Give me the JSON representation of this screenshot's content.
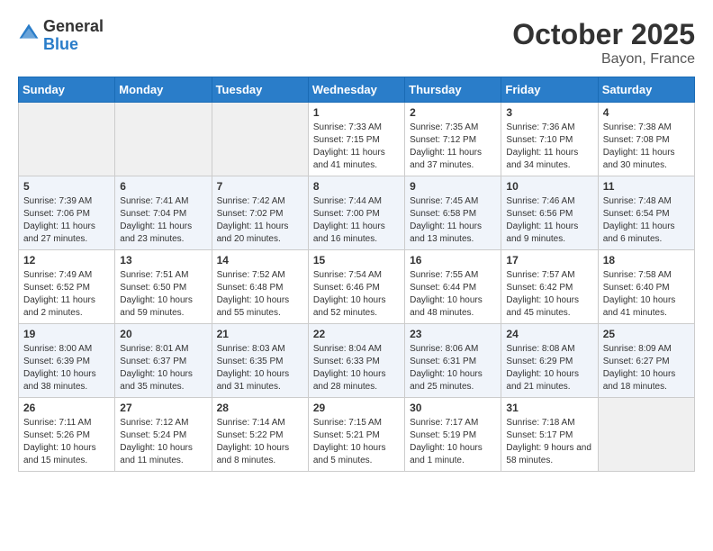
{
  "header": {
    "logo_general": "General",
    "logo_blue": "Blue",
    "month_year": "October 2025",
    "location": "Bayon, France"
  },
  "days_of_week": [
    "Sunday",
    "Monday",
    "Tuesday",
    "Wednesday",
    "Thursday",
    "Friday",
    "Saturday"
  ],
  "weeks": [
    [
      {
        "day": "",
        "sunrise": "",
        "sunset": "",
        "daylight": "",
        "empty": true
      },
      {
        "day": "",
        "sunrise": "",
        "sunset": "",
        "daylight": "",
        "empty": true
      },
      {
        "day": "",
        "sunrise": "",
        "sunset": "",
        "daylight": "",
        "empty": true
      },
      {
        "day": "1",
        "sunrise": "Sunrise: 7:33 AM",
        "sunset": "Sunset: 7:15 PM",
        "daylight": "Daylight: 11 hours and 41 minutes."
      },
      {
        "day": "2",
        "sunrise": "Sunrise: 7:35 AM",
        "sunset": "Sunset: 7:12 PM",
        "daylight": "Daylight: 11 hours and 37 minutes."
      },
      {
        "day": "3",
        "sunrise": "Sunrise: 7:36 AM",
        "sunset": "Sunset: 7:10 PM",
        "daylight": "Daylight: 11 hours and 34 minutes."
      },
      {
        "day": "4",
        "sunrise": "Sunrise: 7:38 AM",
        "sunset": "Sunset: 7:08 PM",
        "daylight": "Daylight: 11 hours and 30 minutes."
      }
    ],
    [
      {
        "day": "5",
        "sunrise": "Sunrise: 7:39 AM",
        "sunset": "Sunset: 7:06 PM",
        "daylight": "Daylight: 11 hours and 27 minutes."
      },
      {
        "day": "6",
        "sunrise": "Sunrise: 7:41 AM",
        "sunset": "Sunset: 7:04 PM",
        "daylight": "Daylight: 11 hours and 23 minutes."
      },
      {
        "day": "7",
        "sunrise": "Sunrise: 7:42 AM",
        "sunset": "Sunset: 7:02 PM",
        "daylight": "Daylight: 11 hours and 20 minutes."
      },
      {
        "day": "8",
        "sunrise": "Sunrise: 7:44 AM",
        "sunset": "Sunset: 7:00 PM",
        "daylight": "Daylight: 11 hours and 16 minutes."
      },
      {
        "day": "9",
        "sunrise": "Sunrise: 7:45 AM",
        "sunset": "Sunset: 6:58 PM",
        "daylight": "Daylight: 11 hours and 13 minutes."
      },
      {
        "day": "10",
        "sunrise": "Sunrise: 7:46 AM",
        "sunset": "Sunset: 6:56 PM",
        "daylight": "Daylight: 11 hours and 9 minutes."
      },
      {
        "day": "11",
        "sunrise": "Sunrise: 7:48 AM",
        "sunset": "Sunset: 6:54 PM",
        "daylight": "Daylight: 11 hours and 6 minutes."
      }
    ],
    [
      {
        "day": "12",
        "sunrise": "Sunrise: 7:49 AM",
        "sunset": "Sunset: 6:52 PM",
        "daylight": "Daylight: 11 hours and 2 minutes."
      },
      {
        "day": "13",
        "sunrise": "Sunrise: 7:51 AM",
        "sunset": "Sunset: 6:50 PM",
        "daylight": "Daylight: 10 hours and 59 minutes."
      },
      {
        "day": "14",
        "sunrise": "Sunrise: 7:52 AM",
        "sunset": "Sunset: 6:48 PM",
        "daylight": "Daylight: 10 hours and 55 minutes."
      },
      {
        "day": "15",
        "sunrise": "Sunrise: 7:54 AM",
        "sunset": "Sunset: 6:46 PM",
        "daylight": "Daylight: 10 hours and 52 minutes."
      },
      {
        "day": "16",
        "sunrise": "Sunrise: 7:55 AM",
        "sunset": "Sunset: 6:44 PM",
        "daylight": "Daylight: 10 hours and 48 minutes."
      },
      {
        "day": "17",
        "sunrise": "Sunrise: 7:57 AM",
        "sunset": "Sunset: 6:42 PM",
        "daylight": "Daylight: 10 hours and 45 minutes."
      },
      {
        "day": "18",
        "sunrise": "Sunrise: 7:58 AM",
        "sunset": "Sunset: 6:40 PM",
        "daylight": "Daylight: 10 hours and 41 minutes."
      }
    ],
    [
      {
        "day": "19",
        "sunrise": "Sunrise: 8:00 AM",
        "sunset": "Sunset: 6:39 PM",
        "daylight": "Daylight: 10 hours and 38 minutes."
      },
      {
        "day": "20",
        "sunrise": "Sunrise: 8:01 AM",
        "sunset": "Sunset: 6:37 PM",
        "daylight": "Daylight: 10 hours and 35 minutes."
      },
      {
        "day": "21",
        "sunrise": "Sunrise: 8:03 AM",
        "sunset": "Sunset: 6:35 PM",
        "daylight": "Daylight: 10 hours and 31 minutes."
      },
      {
        "day": "22",
        "sunrise": "Sunrise: 8:04 AM",
        "sunset": "Sunset: 6:33 PM",
        "daylight": "Daylight: 10 hours and 28 minutes."
      },
      {
        "day": "23",
        "sunrise": "Sunrise: 8:06 AM",
        "sunset": "Sunset: 6:31 PM",
        "daylight": "Daylight: 10 hours and 25 minutes."
      },
      {
        "day": "24",
        "sunrise": "Sunrise: 8:08 AM",
        "sunset": "Sunset: 6:29 PM",
        "daylight": "Daylight: 10 hours and 21 minutes."
      },
      {
        "day": "25",
        "sunrise": "Sunrise: 8:09 AM",
        "sunset": "Sunset: 6:27 PM",
        "daylight": "Daylight: 10 hours and 18 minutes."
      }
    ],
    [
      {
        "day": "26",
        "sunrise": "Sunrise: 7:11 AM",
        "sunset": "Sunset: 5:26 PM",
        "daylight": "Daylight: 10 hours and 15 minutes."
      },
      {
        "day": "27",
        "sunrise": "Sunrise: 7:12 AM",
        "sunset": "Sunset: 5:24 PM",
        "daylight": "Daylight: 10 hours and 11 minutes."
      },
      {
        "day": "28",
        "sunrise": "Sunrise: 7:14 AM",
        "sunset": "Sunset: 5:22 PM",
        "daylight": "Daylight: 10 hours and 8 minutes."
      },
      {
        "day": "29",
        "sunrise": "Sunrise: 7:15 AM",
        "sunset": "Sunset: 5:21 PM",
        "daylight": "Daylight: 10 hours and 5 minutes."
      },
      {
        "day": "30",
        "sunrise": "Sunrise: 7:17 AM",
        "sunset": "Sunset: 5:19 PM",
        "daylight": "Daylight: 10 hours and 1 minute."
      },
      {
        "day": "31",
        "sunrise": "Sunrise: 7:18 AM",
        "sunset": "Sunset: 5:17 PM",
        "daylight": "Daylight: 9 hours and 58 minutes."
      },
      {
        "day": "",
        "sunrise": "",
        "sunset": "",
        "daylight": "",
        "empty": true
      }
    ]
  ]
}
